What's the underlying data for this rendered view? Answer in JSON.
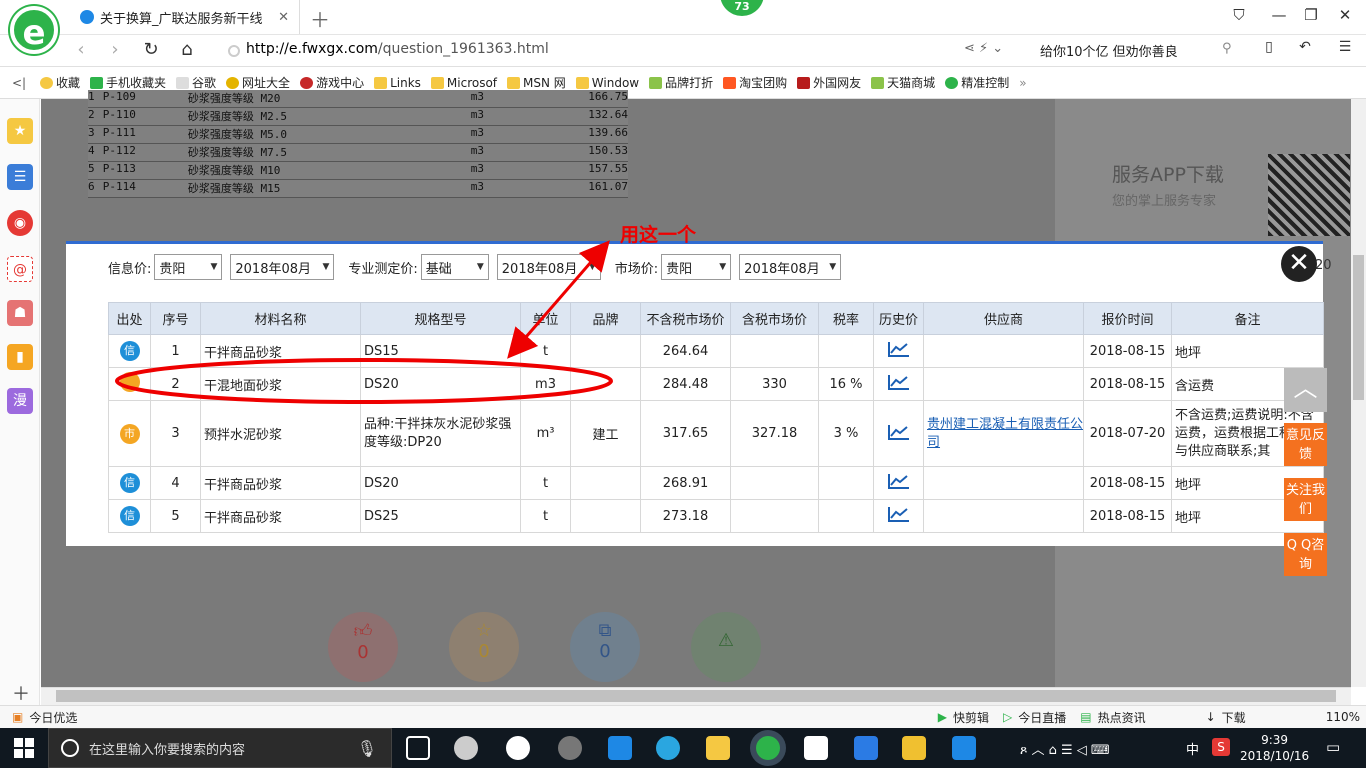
{
  "browser": {
    "tab_title": "关于换算_广联达服务新干线",
    "badge": "73",
    "url_host": "http://e.fwxgx.com",
    "url_path": "/question_1961363.html",
    "search_text": "给你10个亿 但劝你善良",
    "logo_letter": "e"
  },
  "bookmarks": [
    "收藏",
    "手机收藏夹",
    "谷歌",
    "网址大全",
    "游戏中心",
    "Links",
    "Microsof",
    "MSN 网",
    "Window",
    "品牌打折",
    "淘宝团购",
    "外国网友",
    "天猫商城",
    "精准控制"
  ],
  "bg_rows": [
    {
      "idx": "1",
      "code": "P-109",
      "name": "砂浆强度等级 M20",
      "unit": "m3",
      "price": "166.75"
    },
    {
      "idx": "2",
      "code": "P-110",
      "name": "砂浆强度等级 M2.5",
      "unit": "m3",
      "price": "132.64"
    },
    {
      "idx": "3",
      "code": "P-111",
      "name": "砂浆强度等级 M5.0",
      "unit": "m3",
      "price": "139.66"
    },
    {
      "idx": "4",
      "code": "P-112",
      "name": "砂浆强度等级 M7.5",
      "unit": "m3",
      "price": "150.53"
    },
    {
      "idx": "5",
      "code": "P-113",
      "name": "砂浆强度等级 M10",
      "unit": "m3",
      "price": "157.55"
    },
    {
      "idx": "6",
      "code": "P-114",
      "name": "砂浆强度等级 M15",
      "unit": "m3",
      "price": "161.07"
    }
  ],
  "side_panel": {
    "title": "服务APP下载",
    "subtitle": "您的掌上服务专家"
  },
  "vote_counts": [
    "0",
    "0",
    "0"
  ],
  "filters": {
    "info_label": "信息价:",
    "info_city": "贵阳",
    "info_date": "2018年08月",
    "pro_label": "专业测定价:",
    "pro_type": "基础",
    "pro_date": "2018年08月",
    "market_label": "市场价:",
    "market_city": "贵阳",
    "market_date": "2018年08月",
    "clipped": "20"
  },
  "table": {
    "headers": [
      "出处",
      "序号",
      "材料名称",
      "规格型号",
      "单位",
      "品牌",
      "不含税市场价",
      "含税市场价",
      "税率",
      "历史价",
      "供应商",
      "报价时间",
      "备注"
    ],
    "rows": [
      {
        "src": "信",
        "srcType": "xin",
        "no": "1",
        "name": "干拌商品砂浆",
        "spec": "DS15",
        "unit": "t",
        "brand": "",
        "price": "264.64",
        "tax_price": "",
        "rate": "",
        "supplier": "",
        "date": "2018-08-15",
        "note": "地坪"
      },
      {
        "src": "",
        "srcType": "shi",
        "no": "2",
        "name": "干混地面砂浆",
        "spec": "DS20",
        "unit": "m3",
        "brand": "",
        "price": "284.48",
        "tax_price": "330",
        "rate": "16 %",
        "supplier": "",
        "date": "2018-08-15",
        "note": "含运费"
      },
      {
        "src": "市",
        "srcType": "shi",
        "no": "3",
        "name": "预拌水泥砂浆",
        "spec": "品种:干拌抹灰水泥砂浆强度等级:DP20",
        "unit": "m³",
        "brand": "建工",
        "price": "317.65",
        "tax_price": "327.18",
        "rate": "3 %",
        "supplier": "贵州建工混凝土有限责任公司",
        "date": "2018-07-20",
        "note": "不含运费;运费说明:不含运费，运费根据工程情行与供应商联系;其"
      },
      {
        "src": "信",
        "srcType": "xin",
        "no": "4",
        "name": "干拌商品砂浆",
        "spec": "DS20",
        "unit": "t",
        "brand": "",
        "price": "268.91",
        "tax_price": "",
        "rate": "",
        "supplier": "",
        "date": "2018-08-15",
        "note": "地坪"
      },
      {
        "src": "信",
        "srcType": "xin",
        "no": "5",
        "name": "干拌商品砂浆",
        "spec": "DS25",
        "unit": "t",
        "brand": "",
        "price": "273.18",
        "tax_price": "",
        "rate": "",
        "supplier": "",
        "date": "2018-08-15",
        "note": "地坪"
      }
    ]
  },
  "float_buttons": {
    "feedback": "意见反馈",
    "follow": "关注我们",
    "qq": "Q Q咨询"
  },
  "annotation": {
    "text": "用这一个"
  },
  "status": {
    "left": "今日优选",
    "items": [
      "快剪辑",
      "今日直播",
      "热点资讯",
      "下载"
    ],
    "zoom": "110%"
  },
  "taskbar": {
    "search_placeholder": "在这里输入你要搜索的内容",
    "time": "9:39",
    "date": "2018/10/16",
    "ime": "中"
  }
}
